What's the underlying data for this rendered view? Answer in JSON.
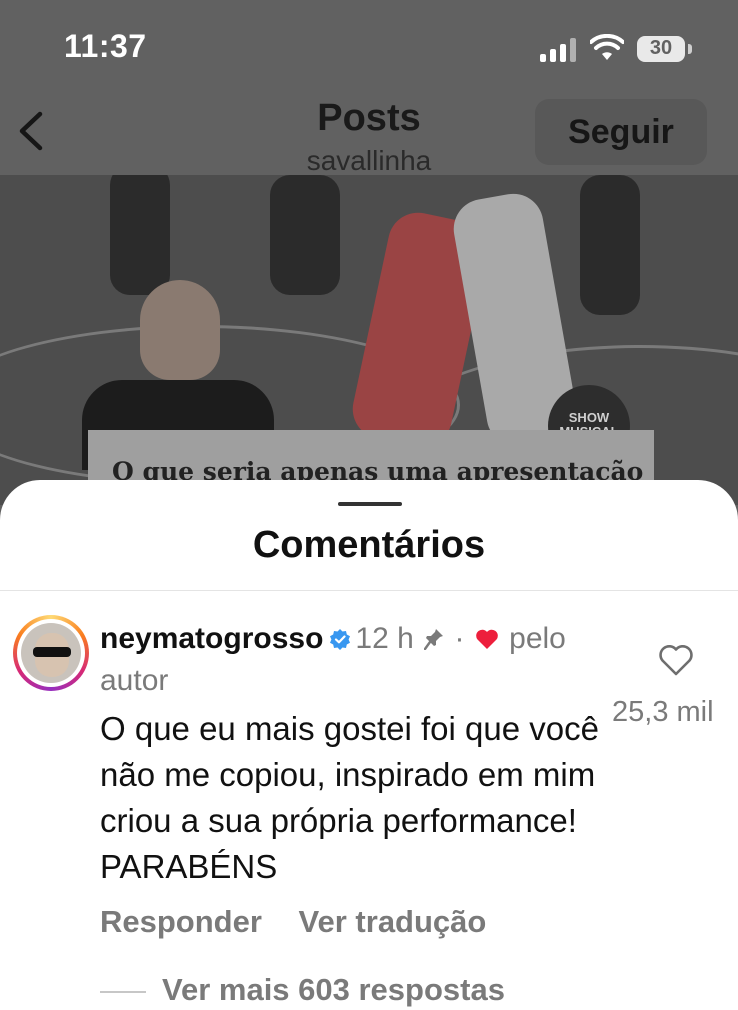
{
  "status_bar": {
    "time": "11:37",
    "battery": "30",
    "icons": [
      "signal-icon",
      "wifi-icon",
      "battery-icon"
    ]
  },
  "header": {
    "title": "Posts",
    "subtitle": "savallinha",
    "follow_label": "Seguir",
    "back_icon": "chevron-left-icon"
  },
  "video": {
    "caption": "O que seria apenas uma apresentação",
    "badge_text": "SHOW MUSICAL"
  },
  "comments": {
    "title": "Comentários",
    "items": [
      {
        "username": "neymatogrosso",
        "verified": true,
        "time": "12 h",
        "liked_by_author": "pelo",
        "liked_by_author_cont": "autor",
        "text": "O que eu mais gostei foi que você não me copiou, inspirado em mim criou a sua própria performance! PARABÉNS",
        "likes": "25,3 mil",
        "reply_label": "Responder",
        "translate_label": "Ver tradução",
        "more_replies": "Ver mais 603 respostas"
      }
    ]
  },
  "colors": {
    "heart": "#ed1f3c",
    "verified": "#3897f0",
    "muted_text": "#7a7a7a"
  }
}
